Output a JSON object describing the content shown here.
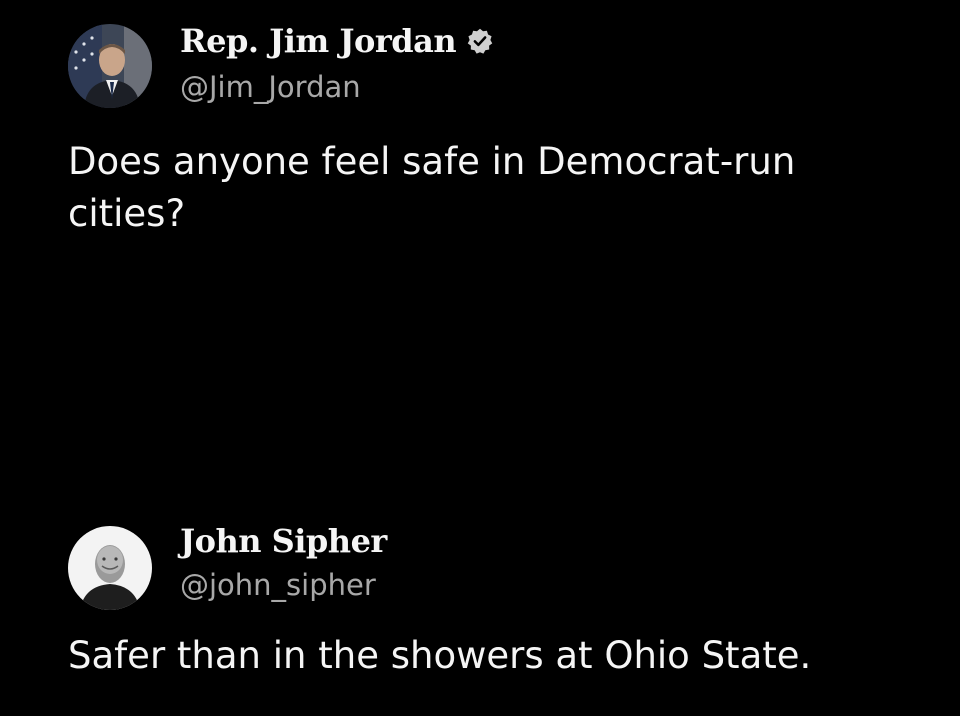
{
  "original_post": {
    "author": {
      "display_name": "Rep. Jim Jordan",
      "handle": "@Jim_Jordan",
      "verified": true,
      "badge_icon": "verified-badge-icon",
      "avatar_icon": "profile-photo-avatar"
    },
    "text": "Does anyone feel safe in Democrat-run cities?"
  },
  "reply_post": {
    "author": {
      "display_name": "John Sipher",
      "handle": "@john_sipher",
      "verified": false,
      "avatar_icon": "profile-photo-avatar"
    },
    "text": "Safer than in the showers at Ohio State."
  },
  "colors": {
    "background": "#000000",
    "primary_text": "#f5f5f5",
    "secondary_text": "#a8a8a8",
    "badge": "#cfcfcf"
  }
}
